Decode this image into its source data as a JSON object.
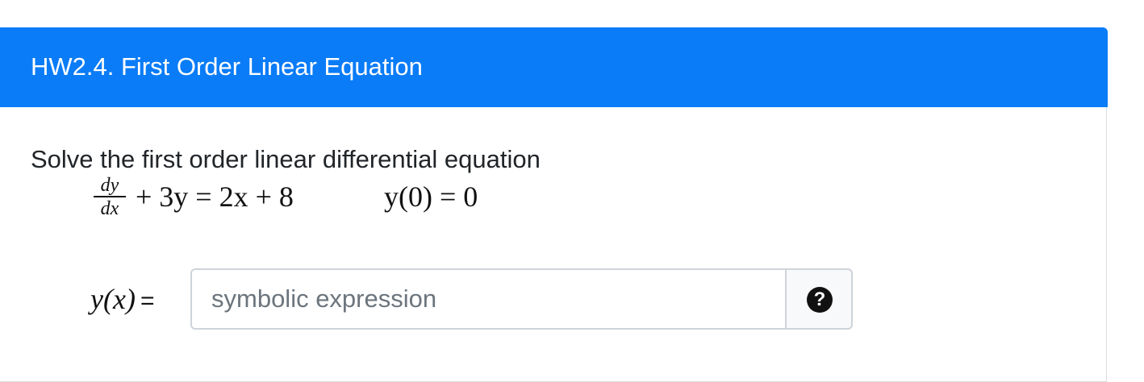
{
  "card": {
    "title": "HW2.4. First Order Linear Equation"
  },
  "question": {
    "prompt": "Solve the first order linear differential equation",
    "equation": {
      "frac_numerator": "dy",
      "frac_denominator": "dx",
      "rest": "+ 3y = 2x + 8",
      "initial_condition": "y(0) = 0"
    }
  },
  "answer": {
    "label": "y(x)",
    "equals": "=",
    "placeholder": "symbolic expression",
    "value": "",
    "help_icon": "question-circle-icon",
    "help_glyph": "?"
  },
  "colors": {
    "header_bg": "#0a7cf7",
    "header_text": "#ffffff",
    "border": "#d9dde1"
  }
}
